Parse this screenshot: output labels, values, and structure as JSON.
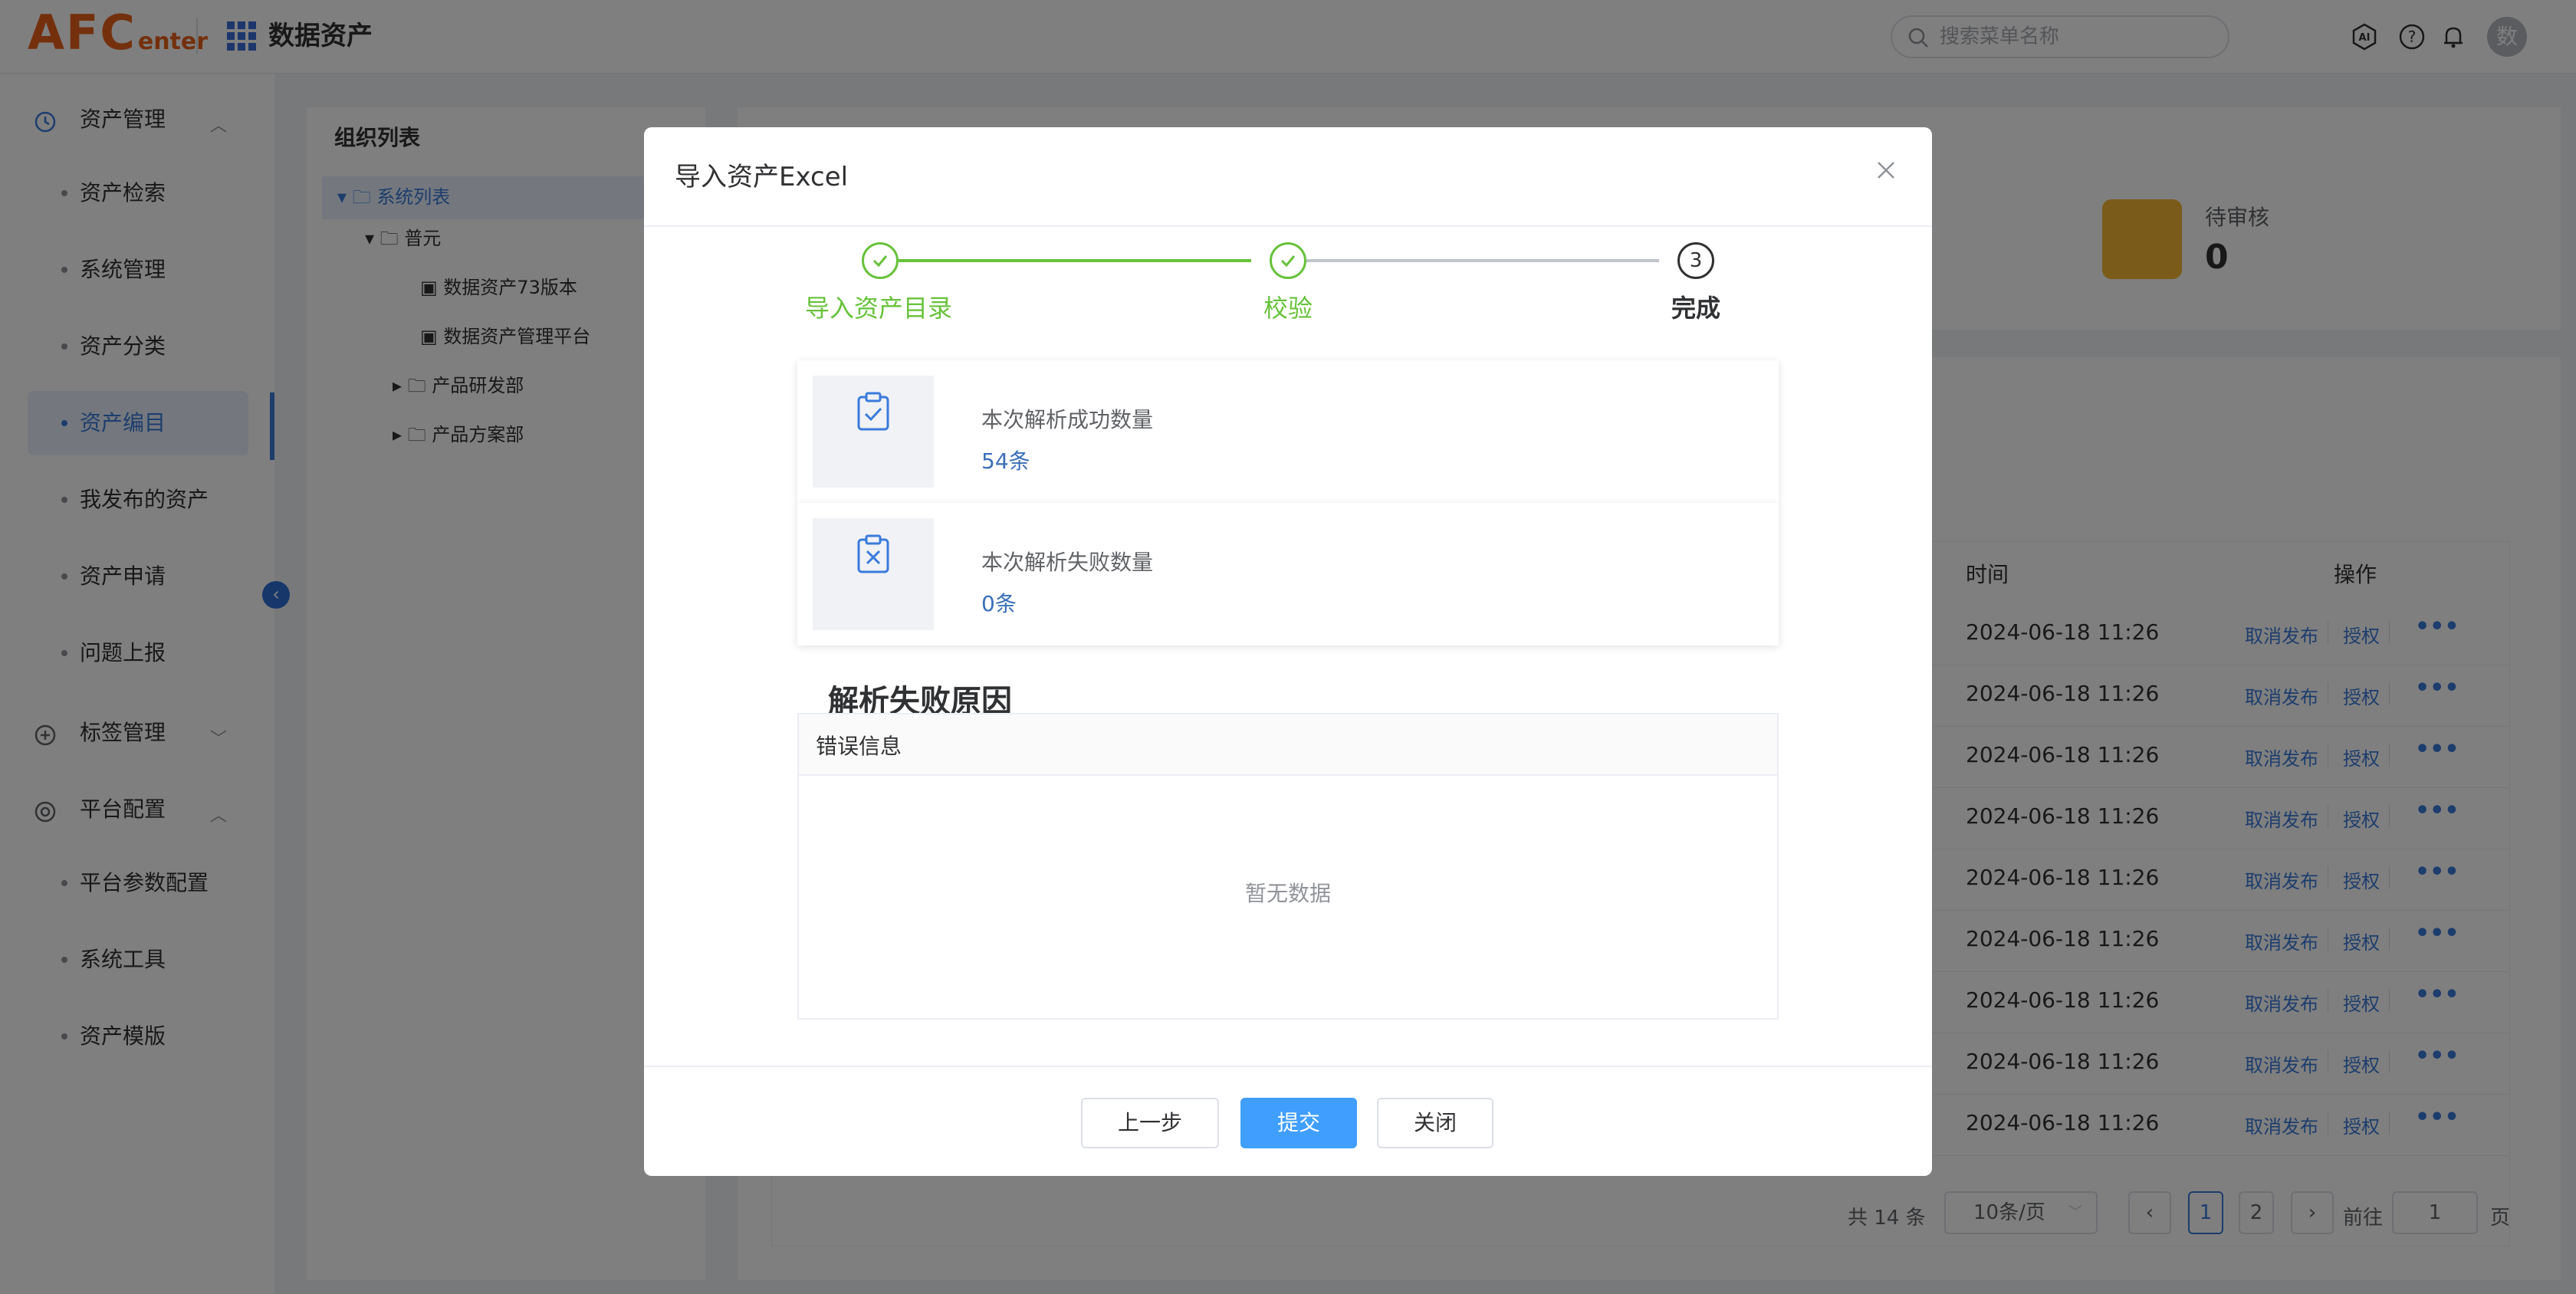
{
  "header": {
    "logo_main": "AFC",
    "logo_sub": "enter",
    "app_title": "数据资产",
    "search_placeholder": "搜索菜单名称",
    "avatar_text": "数"
  },
  "sidebar": {
    "groups": [
      {
        "label": "资产管理",
        "icon": "clock-icon",
        "expanded": true,
        "items": [
          "资产检索",
          "系统管理",
          "资产分类",
          "资产编目",
          "我发布的资产",
          "资产申请",
          "问题上报"
        ]
      },
      {
        "label": "标签管理",
        "icon": "plus-circle-icon",
        "expanded": false,
        "items": []
      },
      {
        "label": "平台配置",
        "icon": "target-icon",
        "expanded": true,
        "items": [
          "平台参数配置",
          "系统工具",
          "资产模版"
        ]
      }
    ],
    "active_item": "资产编目"
  },
  "org_panel": {
    "title": "组织列表",
    "tree": [
      {
        "label": "系统列表",
        "selected": true
      },
      {
        "label": "普元"
      },
      {
        "label": "数据资产73版本"
      },
      {
        "label": "数据资产管理平台"
      },
      {
        "label": "产品研发部"
      },
      {
        "label": "产品方案部"
      }
    ]
  },
  "stats": {
    "pending_label": "待审核",
    "pending_value": "0"
  },
  "table": {
    "headers": {
      "time": "时间",
      "ops": "操作"
    },
    "rows": [
      {
        "time": "2024-06-18 11:26",
        "op1": "取消发布",
        "op2": "授权",
        "more": "•••"
      },
      {
        "time": "2024-06-18 11:26",
        "op1": "取消发布",
        "op2": "授权",
        "more": "•••"
      },
      {
        "time": "2024-06-18 11:26",
        "op1": "取消发布",
        "op2": "授权",
        "more": "•••"
      },
      {
        "time": "2024-06-18 11:26",
        "op1": "取消发布",
        "op2": "授权",
        "more": "•••"
      },
      {
        "time": "2024-06-18 11:26",
        "op1": "取消发布",
        "op2": "授权",
        "more": "•••"
      },
      {
        "time": "2024-06-18 11:26",
        "op1": "取消发布",
        "op2": "授权",
        "more": "•••"
      },
      {
        "time": "2024-06-18 11:26",
        "op1": "取消发布",
        "op2": "授权",
        "more": "•••"
      },
      {
        "time": "2024-06-18 11:26",
        "op1": "取消发布",
        "op2": "授权",
        "more": "•••"
      },
      {
        "time": "2024-06-18 11:26",
        "op1": "取消发布",
        "op2": "授权",
        "more": "•••"
      }
    ],
    "pagination": {
      "total": "共 14 条",
      "page_size": "10条/页",
      "pages": [
        "1",
        "2"
      ],
      "current_page": "1",
      "goto_prefix": "前往",
      "goto_value": "1",
      "goto_suffix": "页"
    }
  },
  "modal": {
    "title": "导入资产Excel",
    "steps": [
      {
        "label": "导入资产目录",
        "status": "done"
      },
      {
        "label": "校验",
        "status": "done"
      },
      {
        "label": "完成",
        "status": "current",
        "number": "3"
      }
    ],
    "success_card": {
      "label": "本次解析成功数量",
      "value": "54条"
    },
    "failure_card": {
      "label": "本次解析失败数量",
      "value": "0条"
    },
    "failure_section_title": "解析失败原因",
    "error_table": {
      "header": "错误信息",
      "empty_text": "暂无数据"
    },
    "buttons": {
      "prev": "上一步",
      "submit": "提交",
      "close": "关闭"
    }
  },
  "colors": {
    "brand": "#e8611a",
    "primary": "#409eff",
    "success": "#67c23a",
    "link": "#3a7bdb"
  }
}
